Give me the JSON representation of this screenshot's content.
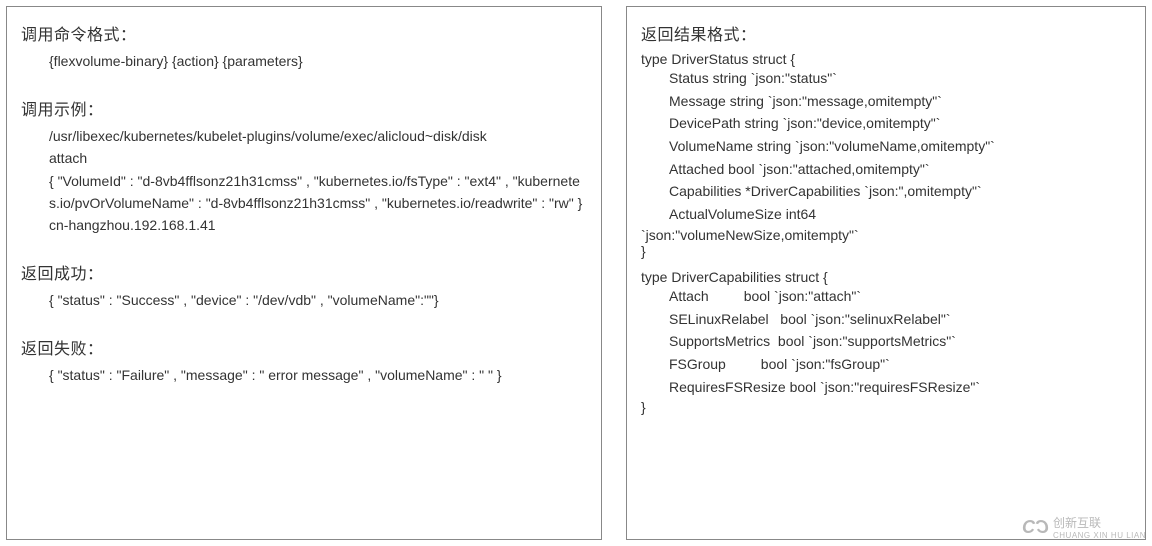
{
  "left": {
    "cmd_format_title": "调用命令格式：",
    "cmd_format_body": "{flexvolume-binary} {action} {parameters}",
    "example_title": "调用示例：",
    "example_lines": [
      "/usr/libexec/kubernetes/kubelet-plugins/volume/exec/alicloud~disk/disk",
      "attach",
      "{ \"VolumeId\" : \"d-8vb4fflsonz21h31cmss\" , \"kubernetes.io/fsType\" : \"ext4\" , \"kubernetes.io/pvOrVolumeName\" : \"d-8vb4fflsonz21h31cmss\" , \"kubernetes.io/readwrite\" : \"rw\" }",
      "cn-hangzhou.192.168.1.41"
    ],
    "success_title": "返回成功：",
    "success_body": "{ \"status\" : \"Success\" ,  \"device\" : \"/dev/vdb\" , \"volumeName\":\"\"}",
    "failure_title": "返回失败：",
    "failure_body": "{ \"status\" : \"Failure\" ,  \"message\" : \" error message\" , \"volumeName\" : \" \" }"
  },
  "right": {
    "result_title": "返回结果格式：",
    "struct1_open": "type DriverStatus struct {",
    "struct1_fields": [
      "Status string `json:\"status\"`",
      "Message string `json:\"message,omitempty\"`",
      "DevicePath string `json:\"device,omitempty\"`",
      "VolumeName string `json:\"volumeName,omitempty\"`",
      "Attached bool `json:\"attached,omitempty\"`",
      "Capabilities *DriverCapabilities `json:\",omitempty\"`",
      "ActualVolumeSize int64"
    ],
    "struct1_extra": "`json:\"volumeNewSize,omitempty\"`",
    "struct1_close": "}",
    "struct2_open": "type DriverCapabilities struct {",
    "struct2_fields": [
      "Attach         bool `json:\"attach\"`",
      "SELinuxRelabel   bool `json:\"selinuxRelabel\"`",
      "SupportsMetrics  bool `json:\"supportsMetrics\"`",
      "FSGroup         bool `json:\"fsGroup\"`",
      "RequiresFSResize bool `json:\"requiresFSResize\"`"
    ],
    "struct2_close": "}"
  },
  "watermark": {
    "brand": "创新互联",
    "sub": "CHUANG XIN HU LIAN"
  }
}
